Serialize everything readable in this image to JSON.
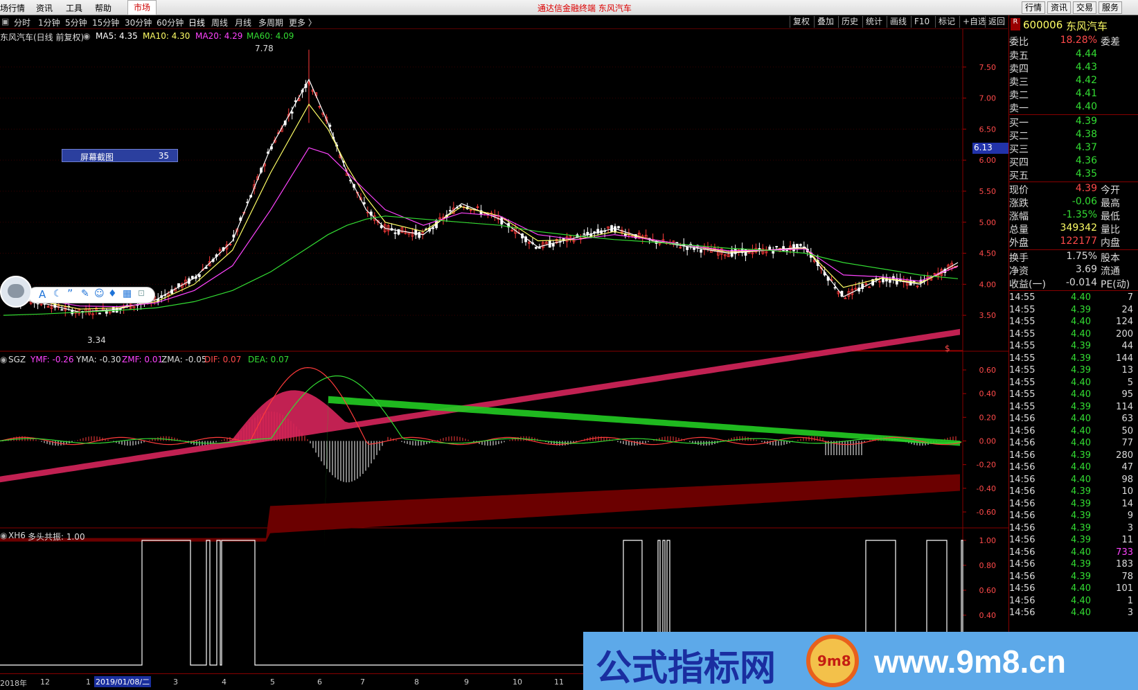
{
  "menubar": {
    "items": [
      "场行情",
      "资讯",
      "工具",
      "帮助"
    ],
    "market_tab": "市场",
    "title": "通达信金融终端 东风汽车",
    "right_buttons": [
      "行情",
      "资讯",
      "交易",
      "服务"
    ]
  },
  "periodbar": {
    "items": [
      "分时",
      "1分钟",
      "5分钟",
      "15分钟",
      "30分钟",
      "60分钟",
      "日线",
      "周线",
      "月线",
      "多周期",
      "更多 〉"
    ],
    "tools": [
      "复权",
      "叠加",
      "历史",
      "统计",
      "画线",
      "F10",
      "标记",
      "+自选",
      "返回"
    ]
  },
  "main_legend": {
    "title": "东风汽车(日线 前复权)",
    "ma5": "MA5: 4.35",
    "ma10": "MA10: 4.30",
    "ma20": "MA20: 4.29",
    "ma60": "MA60: 4.09",
    "high_label": "7.78",
    "low_label": "3.34",
    "price_tag": "6.13"
  },
  "popup": {
    "label": "屏幕截图",
    "value": "35"
  },
  "sgz_legend": {
    "name": "SGZ",
    "ymf": "YMF: -0.26",
    "yma": "YMA: -0.30",
    "zmf": "ZMF: 0.01",
    "zma": "ZMA: -0.05",
    "dif": "DIF: 0.07",
    "dea": "DEA: 0.07",
    "marker": "$"
  },
  "xh6_legend": {
    "name": "XH6",
    "text": "多头共振: 1.00"
  },
  "axes": {
    "main": [
      "7.50",
      "7.00",
      "6.50",
      "6.00",
      "5.50",
      "5.00",
      "4.50",
      "4.00",
      "3.50"
    ],
    "sgz": [
      "0.60",
      "0.40",
      "0.20",
      "0.00",
      "-0.20",
      "-0.40",
      "-0.60"
    ],
    "xh6": [
      "1.00",
      "0.80",
      "0.60",
      "0.40"
    ]
  },
  "dates": [
    "2018年",
    "12",
    "1",
    "2019/01/08/二",
    "3",
    "4",
    "5",
    "6",
    "7",
    "8",
    "9",
    "10",
    "11"
  ],
  "colors": {
    "up": "#ff3b3b",
    "down": "#ffffff",
    "ma5": "#ffffff",
    "ma10": "#ffff66",
    "ma20": "#ff44ff",
    "ma60": "#33dd33",
    "accent": "#800000"
  },
  "quote": {
    "badge": "R",
    "code": "600006",
    "name": "东风汽车",
    "weibi_label": "委比",
    "weibi": "18.28%",
    "weicha_label": "委差",
    "asks": [
      {
        "label": "卖五",
        "price": "4.44"
      },
      {
        "label": "卖四",
        "price": "4.43"
      },
      {
        "label": "卖三",
        "price": "4.42"
      },
      {
        "label": "卖二",
        "price": "4.41"
      },
      {
        "label": "卖一",
        "price": "4.40"
      }
    ],
    "bids": [
      {
        "label": "买一",
        "price": "4.39"
      },
      {
        "label": "买二",
        "price": "4.38"
      },
      {
        "label": "买三",
        "price": "4.37"
      },
      {
        "label": "买四",
        "price": "4.36"
      },
      {
        "label": "买五",
        "price": "4.35"
      }
    ],
    "stats": [
      {
        "l": "现价",
        "v": "4.39",
        "r": "今开",
        "c": "#ff4a4a"
      },
      {
        "l": "涨跌",
        "v": "-0.06",
        "r": "最高",
        "c": "#33dd33"
      },
      {
        "l": "涨幅",
        "v": "-1.35%",
        "r": "最低",
        "c": "#33dd33"
      },
      {
        "l": "总量",
        "v": "349342",
        "r": "量比",
        "c": "#ffff66"
      },
      {
        "l": "外盘",
        "v": "122177",
        "r": "内盘",
        "c": "#ff4a4a"
      }
    ],
    "stats2": [
      {
        "l": "换手",
        "v": "1.75%",
        "r": "股本"
      },
      {
        "l": "净资",
        "v": "3.69",
        "r": "流通"
      },
      {
        "l": "收益(一)",
        "v": "-0.014",
        "r": "PE(动)"
      }
    ]
  },
  "ticks": [
    {
      "t": "14:55",
      "p": "4.40",
      "v": "7"
    },
    {
      "t": "14:55",
      "p": "4.39",
      "v": "24"
    },
    {
      "t": "14:55",
      "p": "4.40",
      "v": "124"
    },
    {
      "t": "14:55",
      "p": "4.40",
      "v": "200"
    },
    {
      "t": "14:55",
      "p": "4.39",
      "v": "44"
    },
    {
      "t": "14:55",
      "p": "4.39",
      "v": "144"
    },
    {
      "t": "14:55",
      "p": "4.39",
      "v": "13"
    },
    {
      "t": "14:55",
      "p": "4.40",
      "v": "5"
    },
    {
      "t": "14:55",
      "p": "4.40",
      "v": "95"
    },
    {
      "t": "14:55",
      "p": "4.39",
      "v": "114"
    },
    {
      "t": "14:56",
      "p": "4.40",
      "v": "63"
    },
    {
      "t": "14:56",
      "p": "4.40",
      "v": "50"
    },
    {
      "t": "14:56",
      "p": "4.40",
      "v": "77"
    },
    {
      "t": "14:56",
      "p": "4.39",
      "v": "280"
    },
    {
      "t": "14:56",
      "p": "4.40",
      "v": "47"
    },
    {
      "t": "14:56",
      "p": "4.40",
      "v": "98"
    },
    {
      "t": "14:56",
      "p": "4.39",
      "v": "10"
    },
    {
      "t": "14:56",
      "p": "4.39",
      "v": "14"
    },
    {
      "t": "14:56",
      "p": "4.39",
      "v": "9"
    },
    {
      "t": "14:56",
      "p": "4.39",
      "v": "3"
    },
    {
      "t": "14:56",
      "p": "4.39",
      "v": "11"
    },
    {
      "t": "14:56",
      "p": "4.40",
      "v": "733"
    },
    {
      "t": "14:56",
      "p": "4.39",
      "v": "183"
    },
    {
      "t": "14:56",
      "p": "4.39",
      "v": "78"
    },
    {
      "t": "14:56",
      "p": "4.40",
      "v": "101"
    },
    {
      "t": "14:56",
      "p": "4.40",
      "v": "1"
    },
    {
      "t": "14:56",
      "p": "4.40",
      "v": "3"
    }
  ],
  "watermark": {
    "text": "公式指标网",
    "url": "www.9m8.cn",
    "seal": "9m8"
  },
  "chart_data": {
    "type": "line",
    "series": [
      {
        "name": "MA5",
        "x": [
          0,
          10,
          20,
          30,
          40,
          50,
          60,
          70,
          80,
          85,
          90,
          95,
          100,
          110,
          120,
          130,
          140,
          150,
          160,
          170,
          180,
          190,
          200,
          210,
          220,
          230,
          240,
          250
        ],
        "values": [
          3.8,
          3.7,
          3.55,
          3.6,
          3.75,
          4.1,
          4.7,
          6.2,
          7.3,
          6.6,
          5.8,
          5.2,
          4.9,
          4.8,
          5.3,
          5.05,
          4.6,
          4.75,
          4.9,
          4.7,
          4.6,
          4.5,
          4.55,
          4.6,
          3.8,
          4.1,
          4.0,
          4.35
        ]
      },
      {
        "name": "MA10",
        "values": [
          3.8,
          3.72,
          3.6,
          3.62,
          3.72,
          4.0,
          4.55,
          5.8,
          6.9,
          6.5,
          5.9,
          5.4,
          5.0,
          4.85,
          5.25,
          5.1,
          4.7,
          4.72,
          4.85,
          4.72,
          4.62,
          4.52,
          4.55,
          4.58,
          3.95,
          4.1,
          4.02,
          4.3
        ]
      },
      {
        "name": "MA20",
        "values": [
          3.85,
          3.75,
          3.65,
          3.64,
          3.7,
          3.9,
          4.3,
          5.2,
          6.2,
          6.1,
          5.8,
          5.5,
          5.2,
          4.95,
          5.15,
          5.1,
          4.8,
          4.72,
          4.8,
          4.72,
          4.62,
          4.54,
          4.55,
          4.57,
          4.15,
          4.12,
          4.05,
          4.29
        ]
      },
      {
        "name": "MA60",
        "values": [
          3.5,
          3.52,
          3.55,
          3.58,
          3.62,
          3.72,
          3.9,
          4.2,
          4.6,
          4.8,
          4.95,
          5.05,
          5.1,
          5.05,
          5.0,
          4.95,
          4.85,
          4.78,
          4.72,
          4.68,
          4.63,
          4.58,
          4.55,
          4.5,
          4.35,
          4.25,
          4.15,
          4.09
        ]
      }
    ],
    "ylim": [
      3.2,
      8.0
    ],
    "annotations": [
      "7.78",
      "3.34"
    ]
  }
}
